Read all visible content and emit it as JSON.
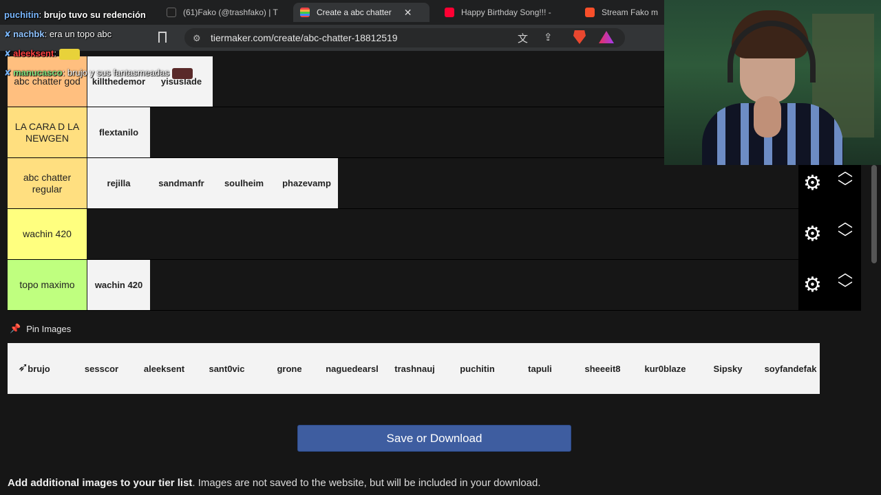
{
  "browser": {
    "tabs": [
      {
        "label": "(61)Fako (@trashfako) | T",
        "color": "#1f1f1f"
      },
      {
        "label": "Create a abc chatter",
        "color": "#1f1f1f"
      },
      {
        "label": "Happy Birthday Song!!! -",
        "color": "#ff0033"
      },
      {
        "label": "Stream Fako m",
        "color": "#f94f2a"
      }
    ],
    "active_tab_close": "✕",
    "url": "tiermaker.com/create/abc-chatter-18812519"
  },
  "tiers": [
    {
      "label": "abc chatter god",
      "color": "#ffbf7f",
      "items": [
        "killthedemor",
        "yisuslade"
      ]
    },
    {
      "label": "LA CARA D LA NEWGEN",
      "color": "#ffdf7f",
      "items": [
        "flextanilo"
      ]
    },
    {
      "label": "abc chatter regular",
      "color": "#ffdf80",
      "items": [
        "rejilla",
        "sandmanfr",
        "soulheim",
        "phazevamp"
      ]
    },
    {
      "label": "wachin 420",
      "color": "#ffff7f",
      "items": []
    },
    {
      "label": "topo maximo",
      "color": "#bfff7f",
      "items": [
        "wachin 420"
      ]
    }
  ],
  "pin": {
    "label": "Pin Images",
    "items": [
      "brujo",
      "sesscor",
      "aleeksent",
      "sant0vic",
      "grone",
      "naguedearsl",
      "trashnauj",
      "puchitin",
      "tapuli",
      "sheeeit8",
      "kur0blaze",
      "Sipsky",
      "soyfandefak"
    ]
  },
  "save_button": "Save or Download",
  "footer": {
    "bold": "Add additional images to your tier list",
    "rest": ". Images are not saved to the website, but will be included in your download."
  },
  "chat": [
    {
      "user": "puchitin",
      "user_color": "#7ab8ff",
      "msg": "brujo tuvo su redención"
    },
    {
      "user": "nachbk",
      "user_color": "#8fc3ff",
      "msg": "era un topo abc"
    },
    {
      "user": "aleeksent",
      "user_color": "#ff4040",
      "msg": ""
    },
    {
      "user": "manucasco",
      "user_color": "#7ee07e",
      "msg": "brujo y sus fantasmeadas"
    }
  ]
}
